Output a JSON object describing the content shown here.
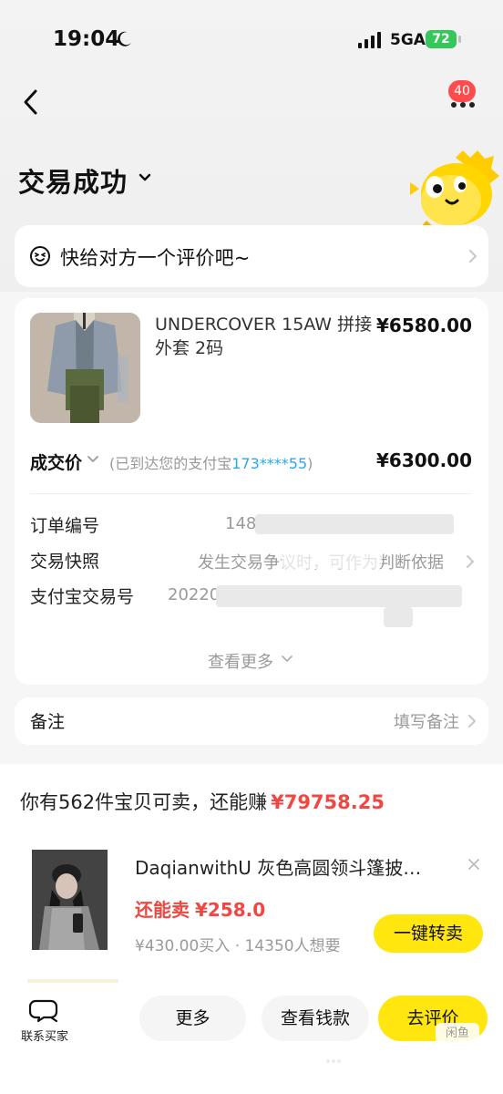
{
  "status_bar": {
    "time": "19:04",
    "network": "5GA",
    "battery": "72"
  },
  "header": {
    "badge_count": "40",
    "title": "交易成功"
  },
  "review_prompt": {
    "text": "快给对方一个评价吧~"
  },
  "order": {
    "product_name": "UNDERCOVER 15AW 拼接外套 2码",
    "product_price": "¥6580.00",
    "deal_label": "成交价",
    "deal_note_prefix": "(已到达您的支付宝",
    "deal_account": "173****55",
    "deal_note_suffix": ")",
    "deal_price": "¥6300.00",
    "fields": [
      {
        "label": "订单编号",
        "value": "148"
      },
      {
        "label": "交易快照",
        "value": "发生交易争议时，可作为判断依据"
      },
      {
        "label": "支付宝交易号",
        "value": "20220"
      }
    ],
    "see_more": "查看更多"
  },
  "remark": {
    "label": "备注",
    "hint": "填写备注"
  },
  "sell_section": {
    "summary_prefix": "你有562件宝贝可卖，还能赚",
    "summary_amount": "¥79758.25",
    "recommendation": {
      "title": "DaqianwithU 灰色高圆领斗篷披…",
      "resell_label": "还能卖",
      "resell_price": "¥258.0",
      "meta": "¥430.00买入 · 14350人想要",
      "button": "一键转卖"
    }
  },
  "bottom_bar": {
    "contact_label": "联系买家",
    "buttons": {
      "more": "更多",
      "funds": "查看钱款",
      "review": "去评价"
    },
    "watermark": "闲鱼"
  },
  "colors": {
    "yellow": "#ffe60f",
    "red": "#f04742",
    "blue": "#2aa7e8",
    "gray_text": "#9a9a9a",
    "badge_red": "#ff4b4b"
  },
  "icons": {
    "back": "back-arrow-icon",
    "more": "more-dots-icon",
    "review": "smile-face-icon",
    "contact": "chat-bubble-icon",
    "close": "close-icon",
    "chevron": "chevron-right-icon"
  }
}
